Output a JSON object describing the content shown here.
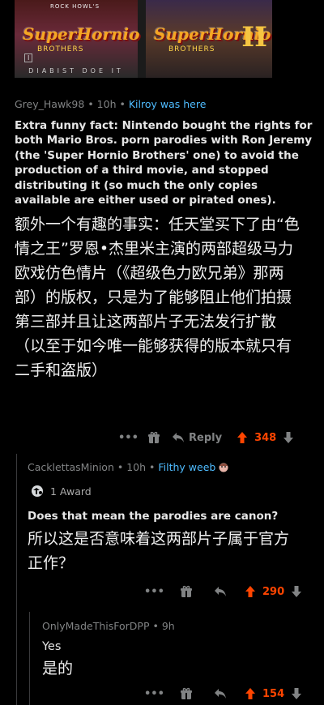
{
  "image": {
    "cover1_top": "ROCK HOWL'S",
    "cover1_title": "SuperHornio",
    "cover1_sub": "BROTHERS",
    "cover1_tag": "Ⅰ",
    "cover1_caption": "DIABIST DOE IT",
    "cover2_title": "SuperHornio",
    "cover2_sub": "BROTHERS",
    "cover2_num": "II"
  },
  "comments": [
    {
      "username": "Grey_Hawk98",
      "time": "10h",
      "flair": "Kilroy was here",
      "body_en": "Extra funny fact: Nintendo bought the rights for both Mario Bros. porn parodies with Ron Jeremy (the 'Super Hornio Brothers' one) to avoid the production of a third movie, and stopped distributing it (so much the only copies available are either used or pirated ones).",
      "body_zh": "额外一个有趣的事实：任天堂买下了由“色情之王”罗恩•杰里米主演的两部超级马力欧戏仿色情片（《超级色力欧兄弟》那两部）的版权，只是为了能够阻止他们拍摄第三部并且让这两部片子无法发行扩散（以至于如今唯一能够获得的版本就只有二手和盗版）",
      "reply_label": "Reply",
      "score": "348"
    },
    {
      "username": "CacklettasMinion",
      "time": "10h",
      "flair": "Filthy weeb",
      "award": "1 Award",
      "body_en": "Does that mean the parodies are canon?",
      "body_zh": "所以这是否意味着这两部片子属于官方正作？",
      "score": "290"
    },
    {
      "username": "OnlyMadeThisForDPP",
      "time": "9h",
      "body_en": "Yes",
      "body_zh": "是的",
      "score": "154"
    }
  ],
  "colors": {
    "background": "#000000",
    "meta": "#818384",
    "flair": "#4fbcff",
    "upvote": "#ff4500"
  },
  "icons": [
    "more-icon",
    "gift-icon",
    "reply-icon",
    "upvote-icon",
    "downvote-icon",
    "award-icon",
    "avatar-flair-icon"
  ]
}
